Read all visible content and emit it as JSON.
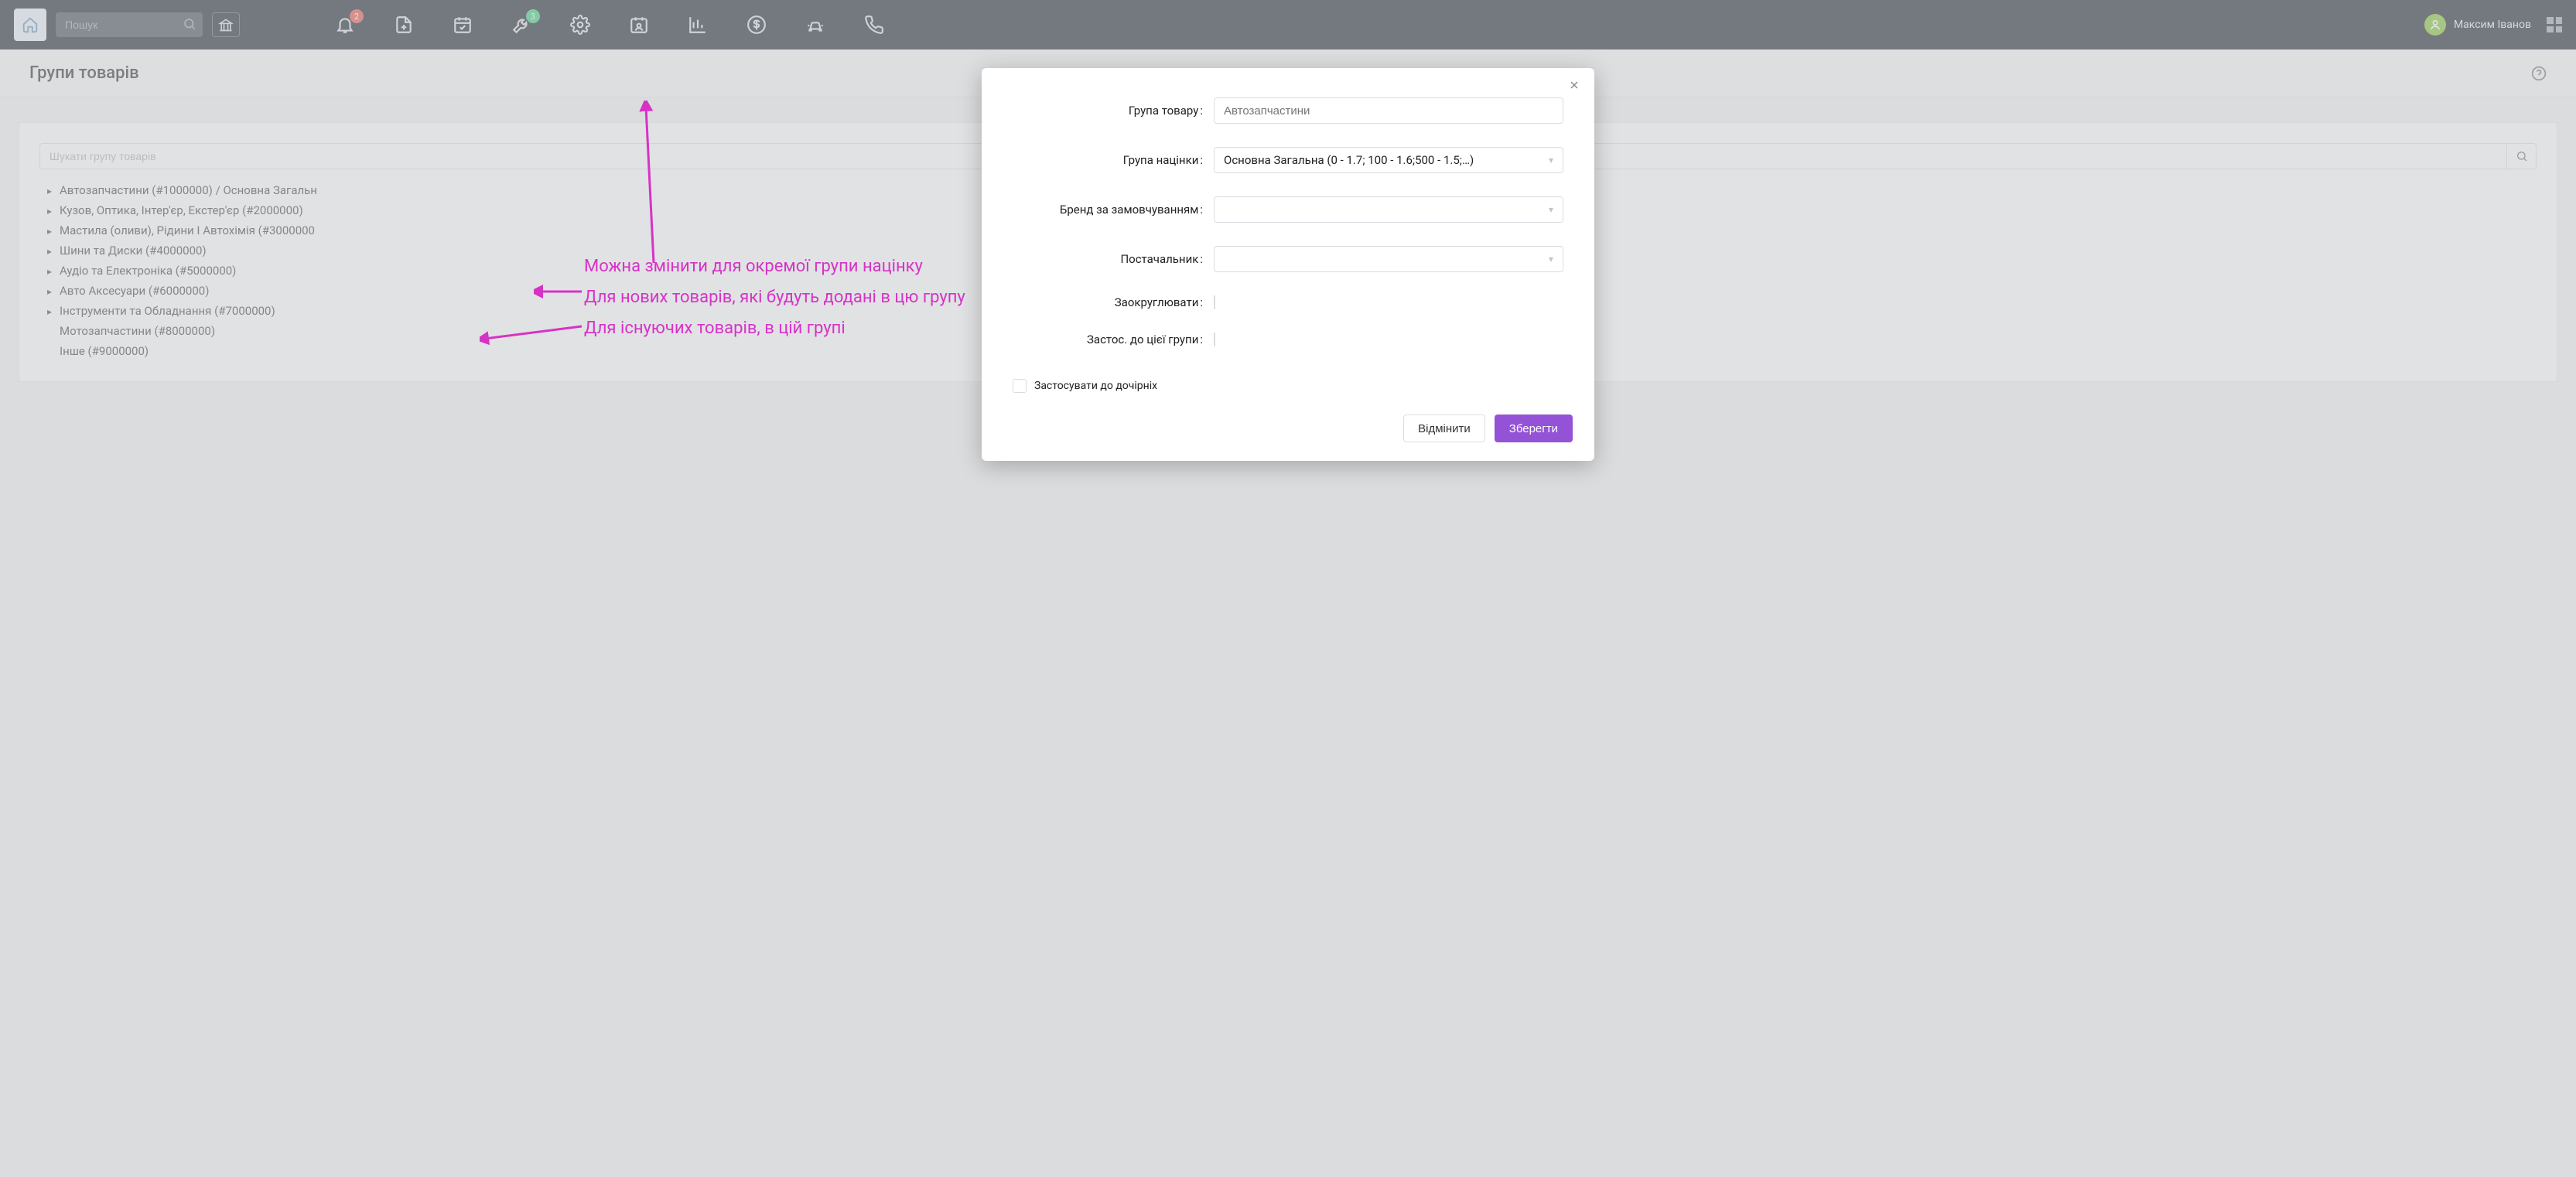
{
  "topbar": {
    "search_placeholder": "Пошук",
    "badges": {
      "bell": "2",
      "wrench": "3"
    },
    "user_name": "Максим Іванов"
  },
  "page": {
    "title": "Групи товарів"
  },
  "panel": {
    "search_placeholder": "Шукати групу товарів",
    "tree": [
      {
        "label": "Автозапчастини (#1000000) / Основна Загальн",
        "children": true
      },
      {
        "label": "Кузов, Оптика, Інтер'єр, Екстер'єр (#2000000)",
        "children": true
      },
      {
        "label": "Мастила (оливи), Рідини І Автохімія (#3000000",
        "children": true
      },
      {
        "label": "Шини та Диски (#4000000)",
        "children": true
      },
      {
        "label": "Аудіо та Електроніка (#5000000)",
        "children": true
      },
      {
        "label": "Авто Аксесуари (#6000000)",
        "children": true
      },
      {
        "label": "Інструменти та Обладнання (#7000000)",
        "children": true
      },
      {
        "label": "Мотозапчастини (#8000000)",
        "children": false
      },
      {
        "label": "Інше (#9000000)",
        "children": false
      }
    ]
  },
  "modal": {
    "fields": {
      "group_label": "Група товару",
      "group_placeholder": "Автозапчастини",
      "markup_label": "Група націнки",
      "markup_value": "Основна Загальна (0 - 1.7; 100 - 1.6;500 - 1.5;…)",
      "brand_label": "Бренд за замовчуванням",
      "supplier_label": "Постачальник",
      "round_label": "Заокруглювати",
      "apply_this_label": "Застос. до цієї групи",
      "apply_children_label": "Застосувати до дочірніх"
    },
    "buttons": {
      "cancel": "Відмінити",
      "save": "Зберегти"
    }
  },
  "annotations": {
    "line1": "Можна змінити для окремої групи націнку",
    "line2": "Для нових товарів, які будуть додані в цю групу",
    "line3": "Для існуючих товарів, в цій групі"
  }
}
